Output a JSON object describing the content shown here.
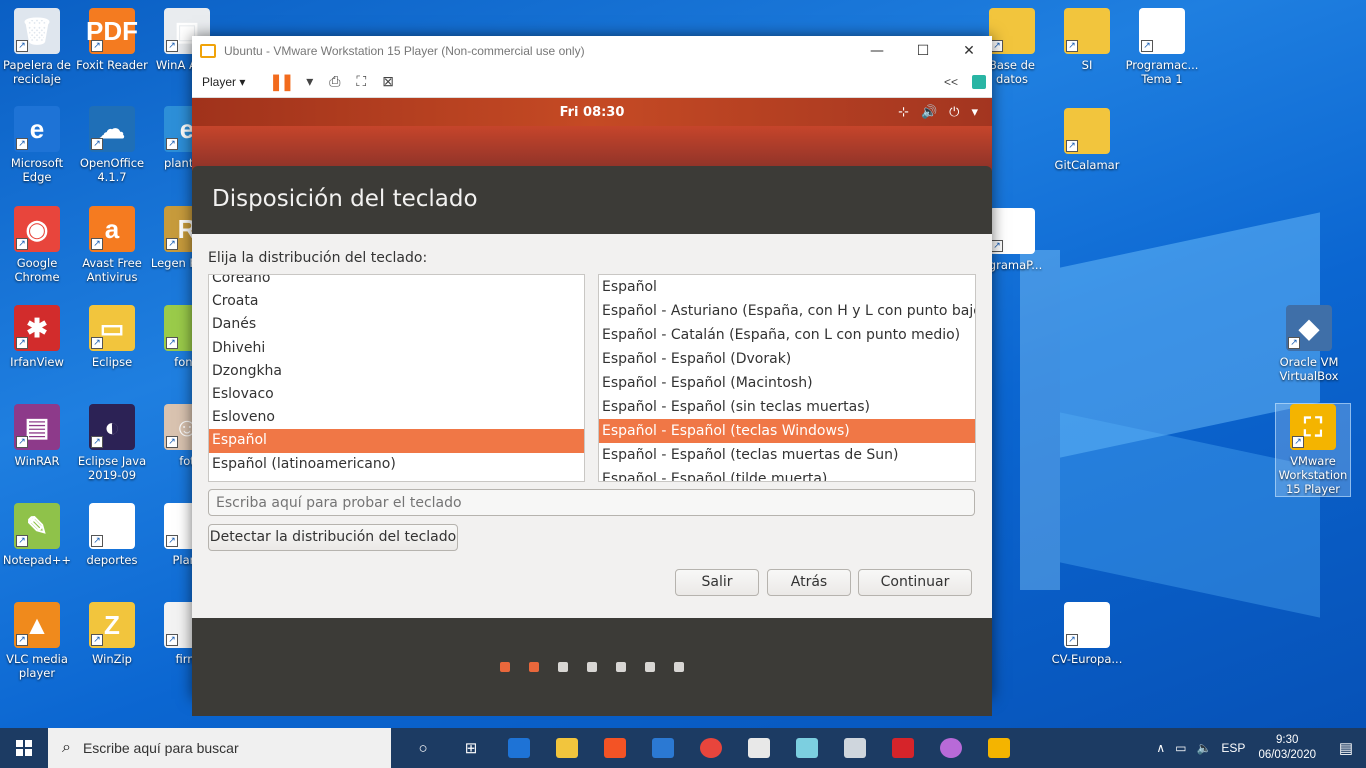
{
  "desktop": {
    "icons": [
      {
        "label": "Papelera de reciclaje",
        "glyph": "🗑",
        "color": "#dfe6ee"
      },
      {
        "label": "Foxit Reader",
        "glyph": "PDF",
        "color": "#f47b20"
      },
      {
        "label": "WinA Archi",
        "glyph": "▣",
        "color": "#e9ecef"
      },
      {
        "label": "Microsoft Edge",
        "glyph": "e",
        "color": "#1e73d6"
      },
      {
        "label": "OpenOffice 4.1.7",
        "glyph": "☁",
        "color": "#1f6fb7"
      },
      {
        "label": "plantilla",
        "glyph": "e",
        "color": "#2d8fd8"
      },
      {
        "label": "Google Chrome",
        "glyph": "◉",
        "color": "#e8453c"
      },
      {
        "label": "Avast Free Antivirus",
        "glyph": "a",
        "color": "#f57b20"
      },
      {
        "label": "Legen Runet",
        "glyph": "R",
        "color": "#c79b3c"
      },
      {
        "label": "IrfanView",
        "glyph": "✱",
        "color": "#d22c2c"
      },
      {
        "label": "Eclipse",
        "glyph": "▭",
        "color": "#f2c53d"
      },
      {
        "label": "fond",
        "glyph": "",
        "color": "#9acb4a"
      },
      {
        "label": "WinRAR",
        "glyph": "▤",
        "color": "#8d3a8a"
      },
      {
        "label": "Eclipse Java 2019-09",
        "glyph": "◐",
        "color": "#2c2255"
      },
      {
        "label": "fot",
        "glyph": "☺",
        "color": "#d9c3b0"
      },
      {
        "label": "Notepad++",
        "glyph": "✎",
        "color": "#8fc24a"
      },
      {
        "label": "deportes",
        "glyph": "",
        "color": "#ffffff"
      },
      {
        "label": "Plant",
        "glyph": "",
        "color": "#ffffff"
      },
      {
        "label": "VLC media player",
        "glyph": "▲",
        "color": "#f08a1c"
      },
      {
        "label": "WinZip",
        "glyph": "Z",
        "color": "#f2c53d"
      },
      {
        "label": "firm",
        "glyph": "",
        "color": "#f3f3f3"
      },
      {
        "label": "Base de datos",
        "glyph": "",
        "color": "#f2c53d"
      },
      {
        "label": "SI",
        "glyph": "",
        "color": "#f2c53d"
      },
      {
        "label": "Programac... Tema 1",
        "glyph": "",
        "color": "#ffffff"
      },
      {
        "label": "GitCalamar",
        "glyph": "",
        "color": "#f2c53d"
      },
      {
        "label": "ogramaP...",
        "glyph": "e",
        "color": "#ffffff"
      },
      {
        "label": "Oracle VM VirtualBox",
        "glyph": "◆",
        "color": "#3f6fa8"
      },
      {
        "label": "VMware Workstation 15 Player",
        "glyph": "⛶",
        "color": "#f4b400"
      },
      {
        "label": "CV-Europa...",
        "glyph": "",
        "color": "#ffffff"
      }
    ]
  },
  "vmware": {
    "title": "Ubuntu - VMware Workstation 15 Player (Non-commercial use only)",
    "player_menu": "Player ▾",
    "minimize": "—",
    "maximize": "☐",
    "close": "✕",
    "collapse": "<<"
  },
  "ubuntu": {
    "clock": "Fri 08:30",
    "installer": {
      "title": "Disposición del teclado",
      "prompt": "Elija la distribución del teclado:",
      "layouts": [
        "Coreano",
        "Croata",
        "Danés",
        "Dhivehi",
        "Dzongkha",
        "Eslovaco",
        "Esloveno",
        "Español",
        "Español (latinoamericano)"
      ],
      "selected_layout": "Español",
      "variants": [
        "Español",
        "Español - Asturiano (España, con H y L con punto bajo)",
        "Español - Catalán (España, con L con punto medio)",
        "Español - Español (Dvorak)",
        "Español - Español (Macintosh)",
        "Español - Español (sin teclas muertas)",
        "Español - Español (teclas Windows)",
        "Español - Español (teclas muertas de Sun)",
        "Español - Español (tilde muerta)"
      ],
      "selected_variant": "Español - Español (teclas Windows)",
      "test_placeholder": "Escriba aquí para probar el teclado",
      "detect_label": "Detectar la distribución del teclado",
      "quit_label": "Salir",
      "back_label": "Atrás",
      "next_label": "Continuar",
      "progress": {
        "total_steps": 7,
        "completed_steps": 2
      }
    }
  },
  "taskbar": {
    "search_placeholder": "Escribe aquí para buscar",
    "language": "ESP",
    "time": "9:30",
    "date": "06/03/2020"
  }
}
